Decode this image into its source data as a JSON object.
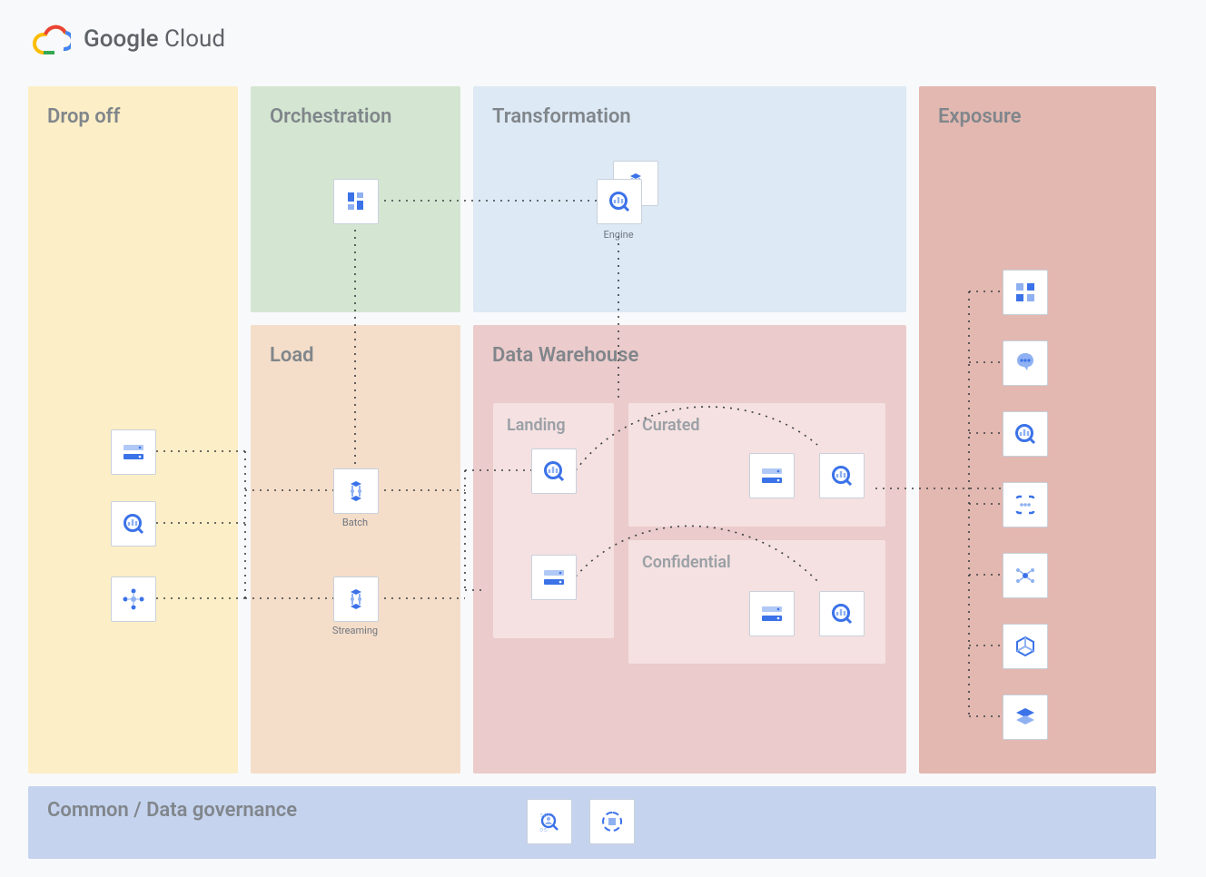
{
  "header": {
    "brand_word1": "Google",
    "brand_word2": "Cloud"
  },
  "zones": {
    "dropoff": "Drop off",
    "orchestration": "Orchestration",
    "transformation": "Transformation",
    "load": "Load",
    "datawarehouse": "Data Warehouse",
    "exposure": "Exposure",
    "governance": "Common / Data governance"
  },
  "sub": {
    "landing": "Landing",
    "curated": "Curated",
    "confidential": "Confidential"
  },
  "labels": {
    "engine": "Engine",
    "batch": "Batch",
    "streaming": "Streaming"
  },
  "icons": {
    "storage": "storage-icon",
    "bigquery": "bigquery-icon",
    "pubsub": "pubsub-icon",
    "composer": "composer-icon",
    "dataflow": "dataflow-icon",
    "looker": "looker-icon",
    "ai": "ai-icon",
    "functions": "functions-icon",
    "dataplex": "dataplex-icon",
    "cube": "cube-icon",
    "layers": "layers-icon",
    "dlp": "dlp-icon",
    "catalog": "catalog-icon"
  }
}
